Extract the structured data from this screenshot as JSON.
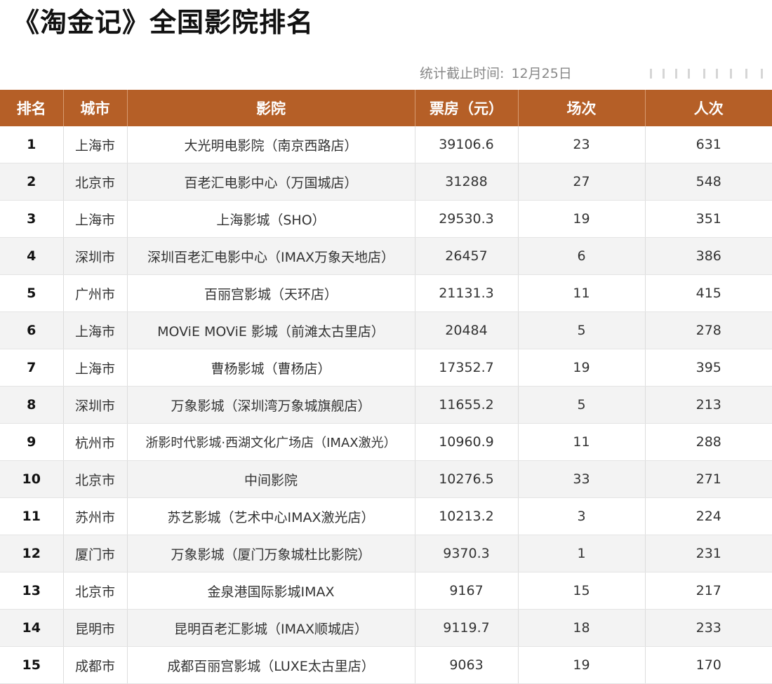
{
  "title": "《淘金记》全国影院排名",
  "stat": {
    "label": "统计截止时间:",
    "date": "12月25日"
  },
  "table": {
    "headers": [
      "排名",
      "城市",
      "影院",
      "票房（元）",
      "场次",
      "人次"
    ],
    "rows": [
      {
        "rank": "1",
        "city": "上海市",
        "cinema": "大光明电影院（南京西路店）",
        "box_office": "39106.6",
        "shows": "23",
        "admissions": "631"
      },
      {
        "rank": "2",
        "city": "北京市",
        "cinema": "百老汇电影中心（万国城店）",
        "box_office": "31288",
        "shows": "27",
        "admissions": "548"
      },
      {
        "rank": "3",
        "city": "上海市",
        "cinema": "上海影城（SHO）",
        "box_office": "29530.3",
        "shows": "19",
        "admissions": "351"
      },
      {
        "rank": "4",
        "city": "深圳市",
        "cinema": "深圳百老汇电影中心（IMAX万象天地店）",
        "box_office": "26457",
        "shows": "6",
        "admissions": "386"
      },
      {
        "rank": "5",
        "city": "广州市",
        "cinema": "百丽宫影城（天环店）",
        "box_office": "21131.3",
        "shows": "11",
        "admissions": "415"
      },
      {
        "rank": "6",
        "city": "上海市",
        "cinema": "MOViE MOViE 影城（前滩太古里店）",
        "box_office": "20484",
        "shows": "5",
        "admissions": "278"
      },
      {
        "rank": "7",
        "city": "上海市",
        "cinema": "曹杨影城（曹杨店）",
        "box_office": "17352.7",
        "shows": "19",
        "admissions": "395"
      },
      {
        "rank": "8",
        "city": "深圳市",
        "cinema": "万象影城（深圳湾万象城旗舰店）",
        "box_office": "11655.2",
        "shows": "5",
        "admissions": "213"
      },
      {
        "rank": "9",
        "city": "杭州市",
        "cinema": "浙影时代影城·西湖文化广场店（IMAX激光）",
        "box_office": "10960.9",
        "shows": "11",
        "admissions": "288"
      },
      {
        "rank": "10",
        "city": "北京市",
        "cinema": "中间影院",
        "box_office": "10276.5",
        "shows": "33",
        "admissions": "271"
      },
      {
        "rank": "11",
        "city": "苏州市",
        "cinema": "苏艺影城（艺术中心IMAX激光店）",
        "box_office": "10213.2",
        "shows": "3",
        "admissions": "224"
      },
      {
        "rank": "12",
        "city": "厦门市",
        "cinema": "万象影城（厦门万象城杜比影院）",
        "box_office": "9370.3",
        "shows": "1",
        "admissions": "231"
      },
      {
        "rank": "13",
        "city": "北京市",
        "cinema": "金泉港国际影城IMAX",
        "box_office": "9167",
        "shows": "15",
        "admissions": "217"
      },
      {
        "rank": "14",
        "city": "昆明市",
        "cinema": "昆明百老汇影城（IMAX顺城店）",
        "box_office": "9119.7",
        "shows": "18",
        "admissions": "233"
      },
      {
        "rank": "15",
        "city": "成都市",
        "cinema": "成都百丽宫影城（LUXE太古里店）",
        "box_office": "9063",
        "shows": "19",
        "admissions": "170"
      }
    ]
  },
  "colors": {
    "header_bg": "#b55f27",
    "header_text": "#ffffff",
    "stripe_bg": "#f3f3f3"
  }
}
